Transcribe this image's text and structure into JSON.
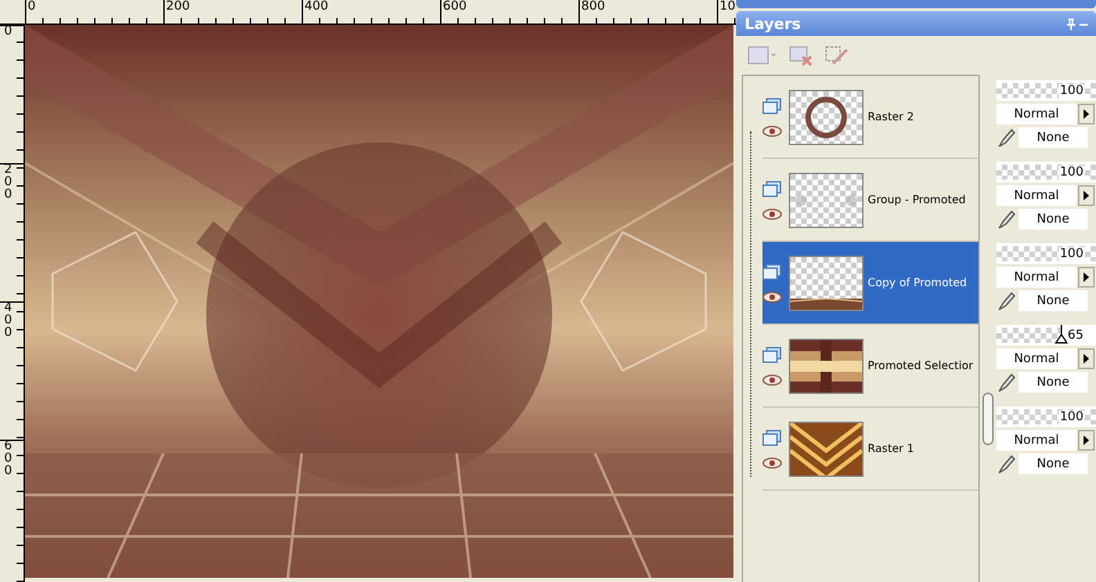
{
  "rulers": {
    "top_labels": [
      "0",
      "200",
      "400",
      "600",
      "800",
      "10"
    ],
    "left_labels": [
      "0",
      "200",
      "400",
      "600"
    ]
  },
  "palette": {
    "title": "Layers"
  },
  "layers": [
    {
      "name": "Raster 2",
      "kind": "ring",
      "selected": false,
      "opacity": "100",
      "level": 1,
      "thumb_visible": false,
      "blend": "Normal",
      "mask": "None"
    },
    {
      "name": "Group - Promoted",
      "kind": "group",
      "selected": false,
      "opacity": "100",
      "level": 1,
      "thumb_visible": false,
      "blend": "Normal",
      "mask": "None"
    },
    {
      "name": "Copy of Promoted",
      "kind": "floor",
      "selected": true,
      "opacity": "100",
      "level": 1,
      "thumb_visible": false,
      "blend": "Normal",
      "mask": "None"
    },
    {
      "name": "Promoted Selectior",
      "kind": "bands",
      "selected": false,
      "opacity": "65",
      "level": 0.65,
      "thumb_visible": true,
      "blend": "Normal",
      "mask": "None"
    },
    {
      "name": "Raster 1",
      "kind": "diamond",
      "selected": false,
      "opacity": "100",
      "level": 1,
      "thumb_visible": false,
      "blend": "Normal",
      "mask": "None"
    }
  ]
}
